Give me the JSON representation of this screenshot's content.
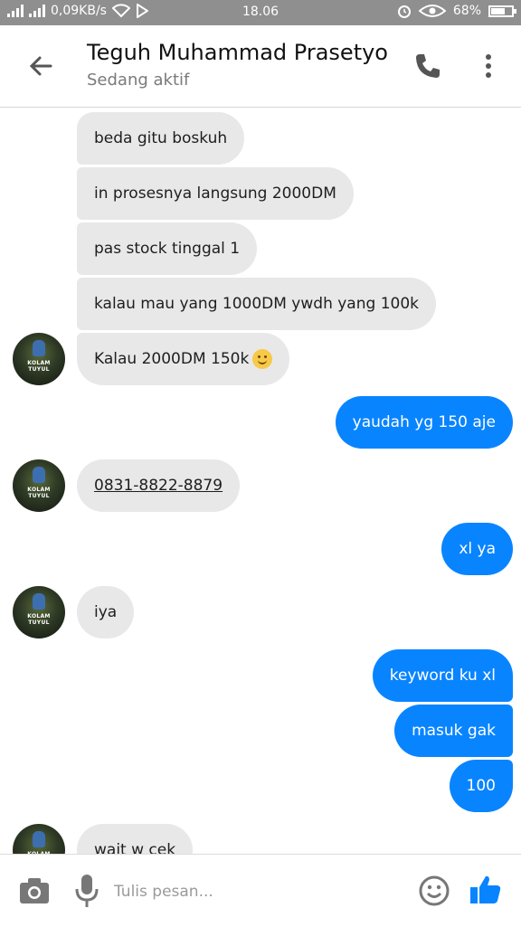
{
  "status_bar": {
    "data_rate": "0,09KB/s",
    "time": "18.06",
    "battery": "68%",
    "battery_level": 0.68
  },
  "header": {
    "contact_name": "Teguh Muhammad Prasetyo",
    "status": "Sedang aktif"
  },
  "avatar": {
    "label": "KOLAM TUYUL"
  },
  "messages": [
    {
      "from": "them",
      "text": "beda gitu boskuh"
    },
    {
      "from": "them",
      "text": "in prosesnya langsung 2000DM"
    },
    {
      "from": "them",
      "text": "pas stock tinggal 1"
    },
    {
      "from": "them",
      "text": "kalau mau yang 1000DM ywdh yang 100k"
    },
    {
      "from": "them",
      "text": "Kalau 2000DM 150k",
      "emoji": "slight-smile"
    },
    {
      "from": "me",
      "text": "yaudah yg 150 aje"
    },
    {
      "from": "them",
      "text": "0831-8822-8879"
    },
    {
      "from": "me",
      "text": "xl ya"
    },
    {
      "from": "them",
      "text": "iya"
    },
    {
      "from": "me",
      "text": "keyword ku xl"
    },
    {
      "from": "me",
      "text": "masuk gak"
    },
    {
      "from": "me",
      "text": "100"
    },
    {
      "from": "them",
      "text": "wait w cek"
    }
  ],
  "composer": {
    "placeholder": "Tulis pesan..."
  },
  "colors": {
    "accent": "#0984ff",
    "incoming_bubble": "#e8e8e8",
    "status_bar": "#8f8f8f"
  },
  "icons": [
    "back-arrow-icon",
    "phone-icon",
    "more-vert-icon",
    "camera-icon",
    "mic-icon",
    "emoji-icon",
    "thumbs-up-icon"
  ]
}
